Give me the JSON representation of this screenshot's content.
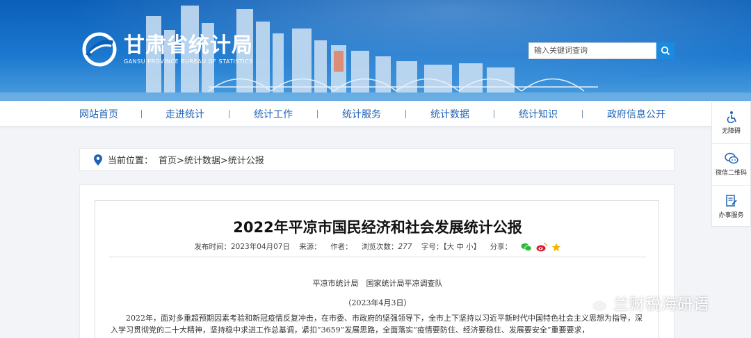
{
  "header": {
    "site_name_cn": "甘肃省统计局",
    "site_name_en": "GANSU PROVINCE BUREAU OF STATISTICS",
    "search_placeholder": "输入关键词查询"
  },
  "nav": {
    "items": [
      "网站首页",
      "走进统计",
      "统计工作",
      "统计服务",
      "统计数据",
      "统计知识",
      "政府信息公开"
    ]
  },
  "side_tools": [
    {
      "label": "无障碍",
      "icon": "accessibility-icon"
    },
    {
      "label": "微信二维码",
      "icon": "wechat-icon"
    },
    {
      "label": "办事服务",
      "icon": "document-edit-icon"
    }
  ],
  "breadcrumb": {
    "label": "当前位置：",
    "path": "首页>统计数据>统计公报"
  },
  "article": {
    "title": "2022年平凉市国民经济和社会发展统计公报",
    "publish_time_label": "发布时间：2023年04月07日",
    "source_label": "来源：",
    "author_label": "作者：",
    "views_label": "浏览次数：",
    "views_value": "277",
    "font_label": "字号：【大 中 小】",
    "share_label": "分享：",
    "issuer": "平凉市统计局　国家统计局平凉调查队",
    "date": "（2023年4月3日）",
    "body": "2022年，面对多重超预期因素考验和新冠疫情反复冲击，在市委、市政府的坚强领导下，全市上下坚持以习近平新时代中国特色社会主义思想为指导，深入学习贯彻党的二十大精神，坚持稳中求进工作总基调，紧扣“3659”发展思路，全面落实“疫情要防住、经济要稳住、发展要安全”重要要求，"
  },
  "watermark": {
    "text": "兰财税海研语"
  },
  "colors": {
    "brand_blue": "#1f63b4",
    "banner_blue": "#0b5fb8",
    "search_button": "#1b8be0"
  }
}
